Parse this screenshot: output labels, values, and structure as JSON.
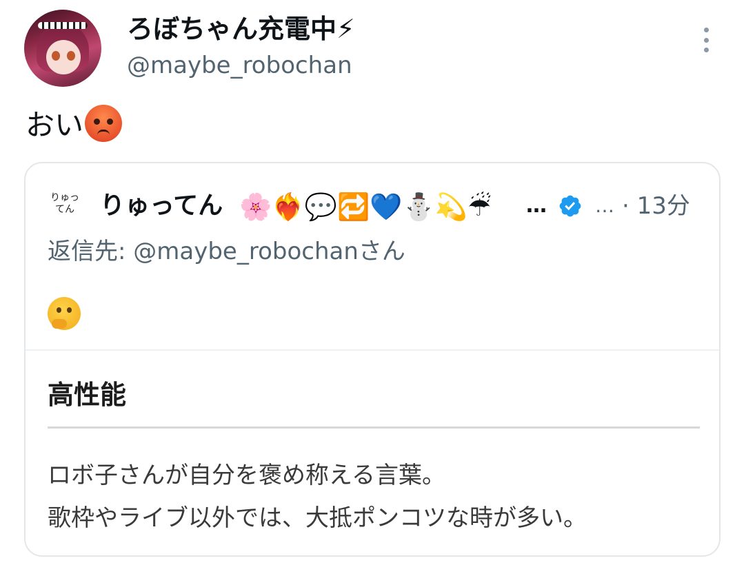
{
  "tweet": {
    "author": {
      "display_name": "ろぼちゃん充電中⚡",
      "handle": "@maybe_robochan"
    },
    "text": "おい",
    "more_icon": "more-vertical-icon"
  },
  "quoted_tweet": {
    "avatar_text_line1": "りゅっ",
    "avatar_text_line2": "てん",
    "display_name": "りゅってん",
    "name_emojis": "🌸❤️‍🔥💬🔁💙⛄💫☔",
    "name_truncated": "…",
    "verified_icon": "verified-badge-icon",
    "header_ellipsis": "…",
    "time": "· 13分",
    "reply_to": "返信先: @maybe_robochanさん",
    "body_emoji": "thinking-face-emoji",
    "card": {
      "title": "高性能",
      "description_line1": "ロボ子さんが自分を褒め称える言葉。",
      "description_line2": "歌枠やライブ以外では、大抵ポンコツな時が多い。"
    }
  },
  "colors": {
    "text_primary": "#0f1419",
    "text_secondary": "#536471",
    "verified": "#1d9bf0",
    "border": "#e3e7ea"
  }
}
